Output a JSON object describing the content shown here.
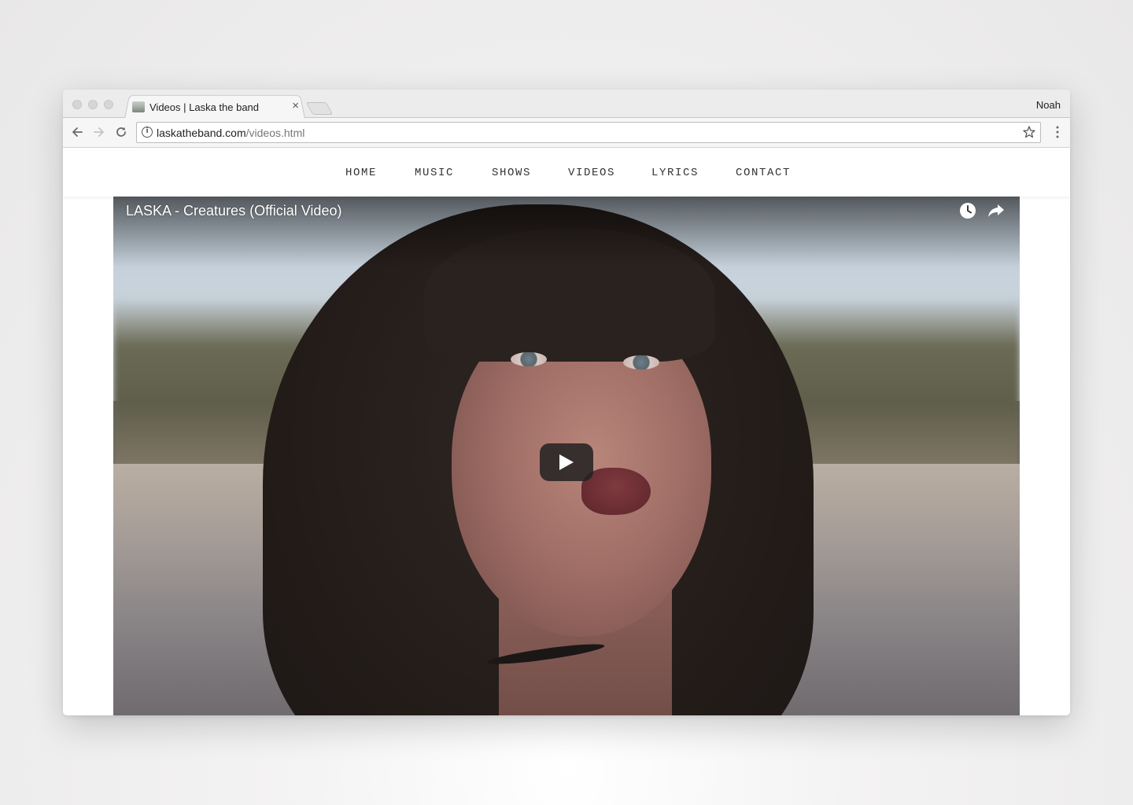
{
  "browser": {
    "tab": {
      "title": "Videos | Laska the band",
      "close_glyph": "×",
      "favicon": "band-photo-favicon"
    },
    "profile_name": "Noah",
    "address_bar": {
      "host": "laskatheband.com",
      "path": "/videos.html",
      "info_glyph": "i"
    },
    "icons": [
      "back-arrow-icon",
      "forward-arrow-icon",
      "reload-icon",
      "info-icon",
      "bookmark-star-icon",
      "menu-dots-icon"
    ]
  },
  "site": {
    "nav": {
      "items": [
        {
          "label": "HOME"
        },
        {
          "label": "MUSIC"
        },
        {
          "label": "SHOWS"
        },
        {
          "label": "VIDEOS"
        },
        {
          "label": "LYRICS"
        },
        {
          "label": "CONTACT"
        }
      ]
    },
    "video": {
      "title": "LASKA - Creatures (Official Video)",
      "icons": [
        "watch-later-icon",
        "share-icon",
        "play-icon"
      ],
      "play_button_color": "#212121"
    }
  },
  "colors": {
    "page_background": "#efeeee",
    "tabstrip": "#ececec",
    "toolbar": "#f6f6f6",
    "nav_text": "#333333"
  }
}
